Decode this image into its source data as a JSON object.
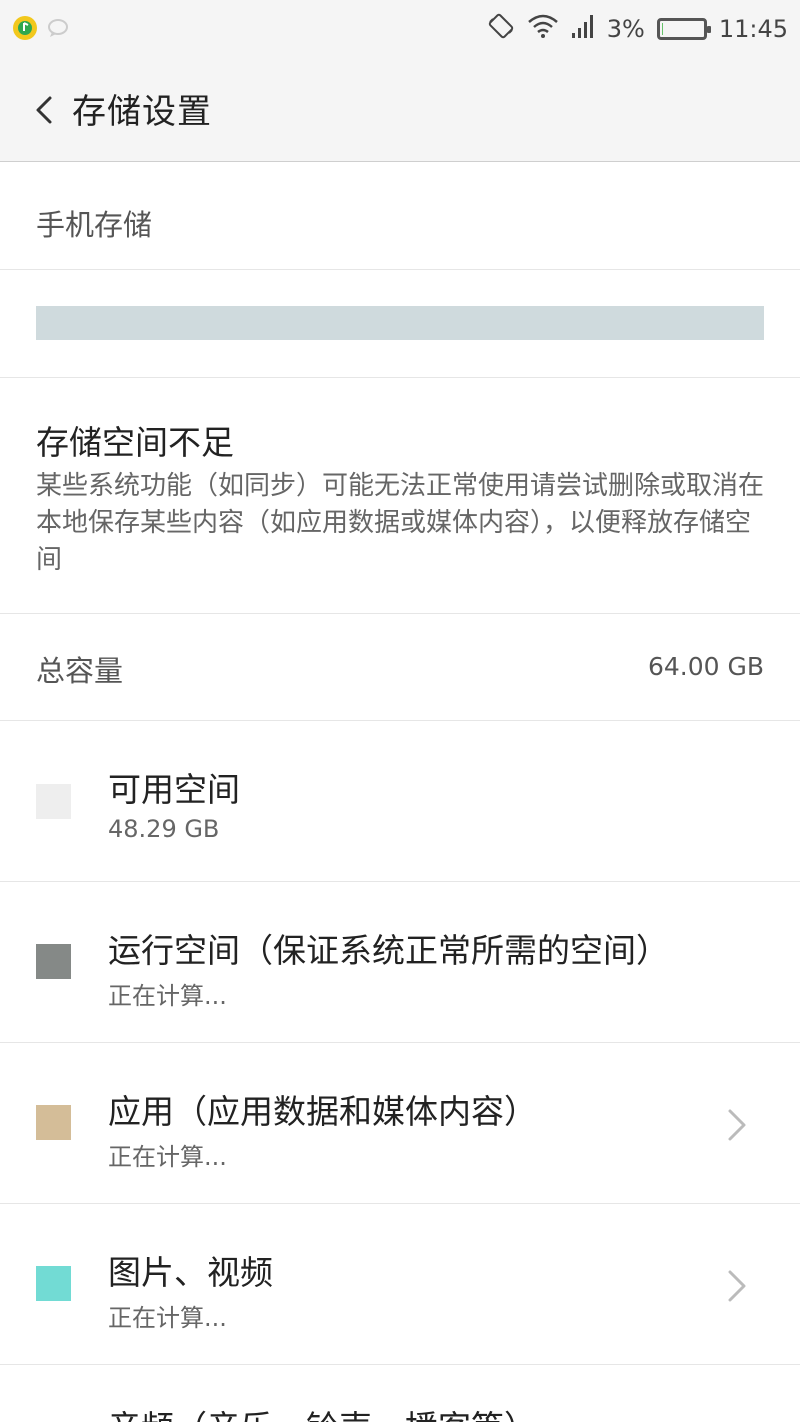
{
  "status_bar": {
    "left_icons": [
      "qq-music-icon",
      "chat-icon"
    ],
    "right_icons": [
      "rotate-lock-icon",
      "wifi-icon",
      "signal-icon"
    ],
    "battery_percent": "3%",
    "battery_level": 0.03,
    "time": "11:45"
  },
  "header": {
    "back_icon": "chevron-left-icon",
    "title": "存储设置"
  },
  "section": {
    "title": "手机存储"
  },
  "usage_bar": {
    "color": "#cfdadd"
  },
  "warning": {
    "title": "存储空间不足",
    "body": "某些系统功能（如同步）可能无法正常使用请尝试删除或取消在本地保存某些内容（如应用数据或媒体内容），以便释放存储空间"
  },
  "total": {
    "label": "总容量",
    "value": "64.00 GB"
  },
  "categories": [
    {
      "name": "可用空间",
      "value": "48.29 GB",
      "color": "#eeeeee",
      "has_chevron": false
    },
    {
      "name": "运行空间（保证系统正常所需的空间）",
      "value": "正在计算...",
      "color": "#858987",
      "has_chevron": false
    },
    {
      "name": "应用（应用数据和媒体内容）",
      "value": "正在计算...",
      "color": "#d4bd98",
      "has_chevron": true
    },
    {
      "name": "图片、视频",
      "value": "正在计算...",
      "color": "#72dbd4",
      "has_chevron": true
    }
  ],
  "partial_category": {
    "name": "音频（音乐、铃声、播客等）"
  }
}
